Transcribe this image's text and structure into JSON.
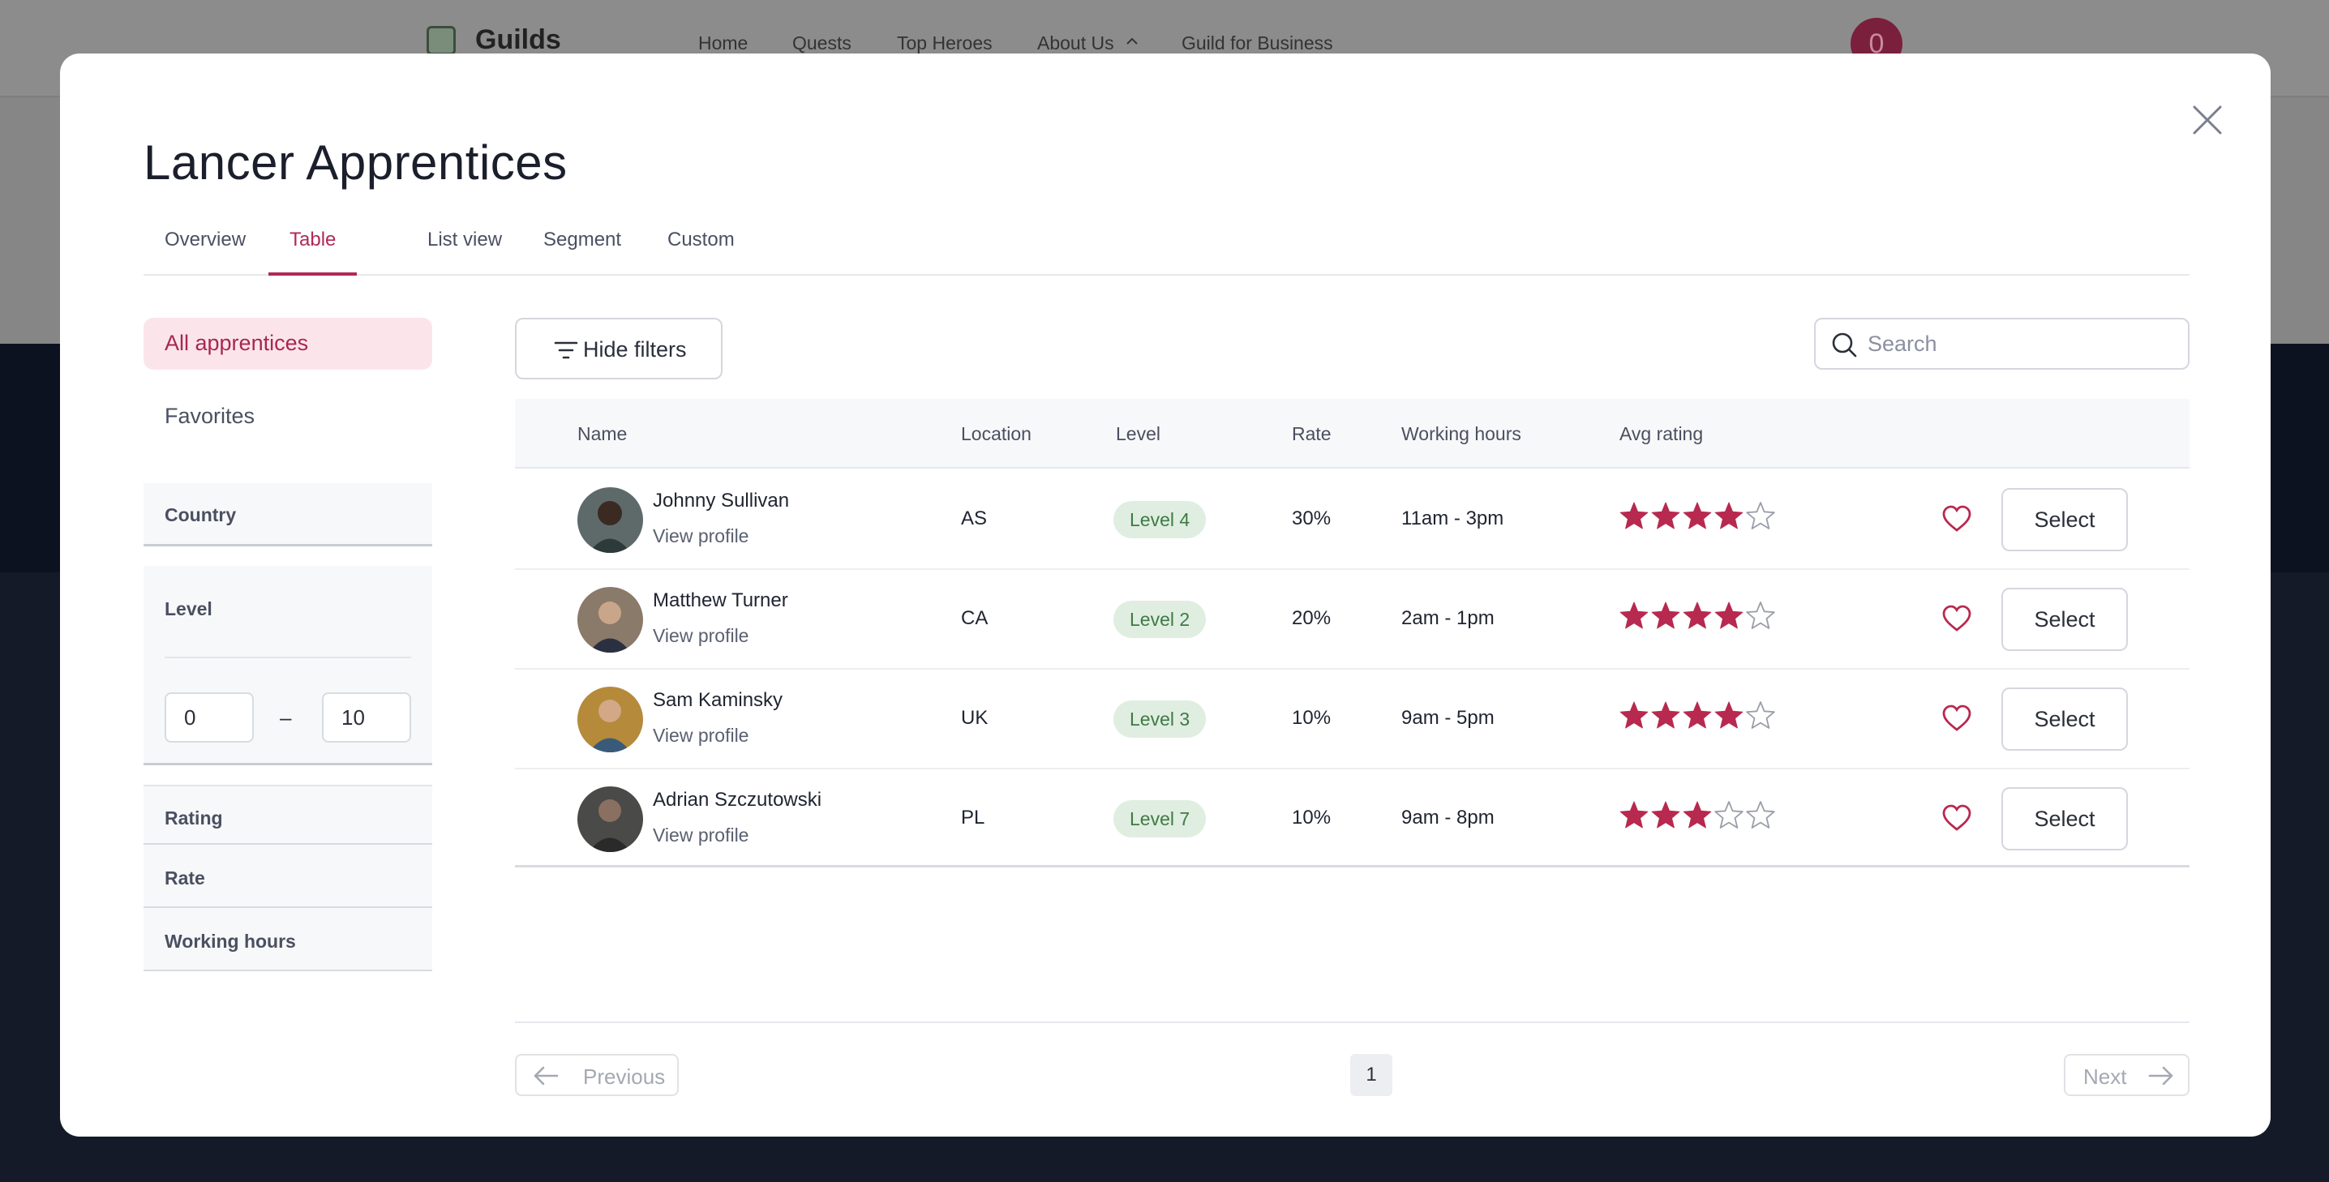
{
  "background": {
    "brand": "Guilds",
    "nav": [
      "Home",
      "Quests",
      "Top Heroes",
      "About Us",
      "Guild for Business"
    ],
    "avatar_initial": "0"
  },
  "modal": {
    "title": "Lancer Apprentices",
    "tabs": [
      {
        "label": "Overview",
        "active": false
      },
      {
        "label": "Table",
        "active": true
      },
      {
        "label": "List view",
        "active": false
      },
      {
        "label": "Segment",
        "active": false
      },
      {
        "label": "Custom",
        "active": false
      }
    ]
  },
  "sidebar": {
    "items": [
      {
        "label": "All apprentices",
        "active": true
      },
      {
        "label": "Favorites",
        "active": false
      }
    ],
    "filters": {
      "country": "Country",
      "level": "Level",
      "level_min": "0",
      "level_sep": "–",
      "level_max": "10",
      "rating": "Rating",
      "rate": "Rate",
      "working_hours": "Working hours"
    }
  },
  "toolbar": {
    "hide_filters": "Hide filters",
    "search_placeholder": "Search"
  },
  "table": {
    "headers": [
      "Name",
      "Location",
      "Level",
      "Rate",
      "Working hours",
      "Avg rating"
    ],
    "view_profile": "View profile",
    "select_label": "Select",
    "rows": [
      {
        "name": "Johnny Sullivan",
        "location": "AS",
        "level": "Level 4",
        "rate": "30%",
        "hours": "11am - 3pm",
        "rating": 4,
        "favorite": false
      },
      {
        "name": "Matthew Turner",
        "location": "CA",
        "level": "Level 2",
        "rate": "20%",
        "hours": "2am - 1pm",
        "rating": 4,
        "favorite": false
      },
      {
        "name": "Sam Kaminsky",
        "location": "UK",
        "level": "Level 3",
        "rate": "10%",
        "hours": "9am - 5pm",
        "rating": 4,
        "favorite": false
      },
      {
        "name": "Adrian Szczutowski",
        "location": "PL",
        "level": "Level 7",
        "rate": "10%",
        "hours": "9am - 8pm",
        "rating": 3,
        "favorite": false
      }
    ]
  },
  "pagination": {
    "previous": "Previous",
    "next": "Next",
    "current_page": "1"
  },
  "colors": {
    "accent": "#b02a55",
    "star": "#b8294f",
    "badge_bg": "#dfeee0",
    "badge_text": "#3f7a45"
  }
}
